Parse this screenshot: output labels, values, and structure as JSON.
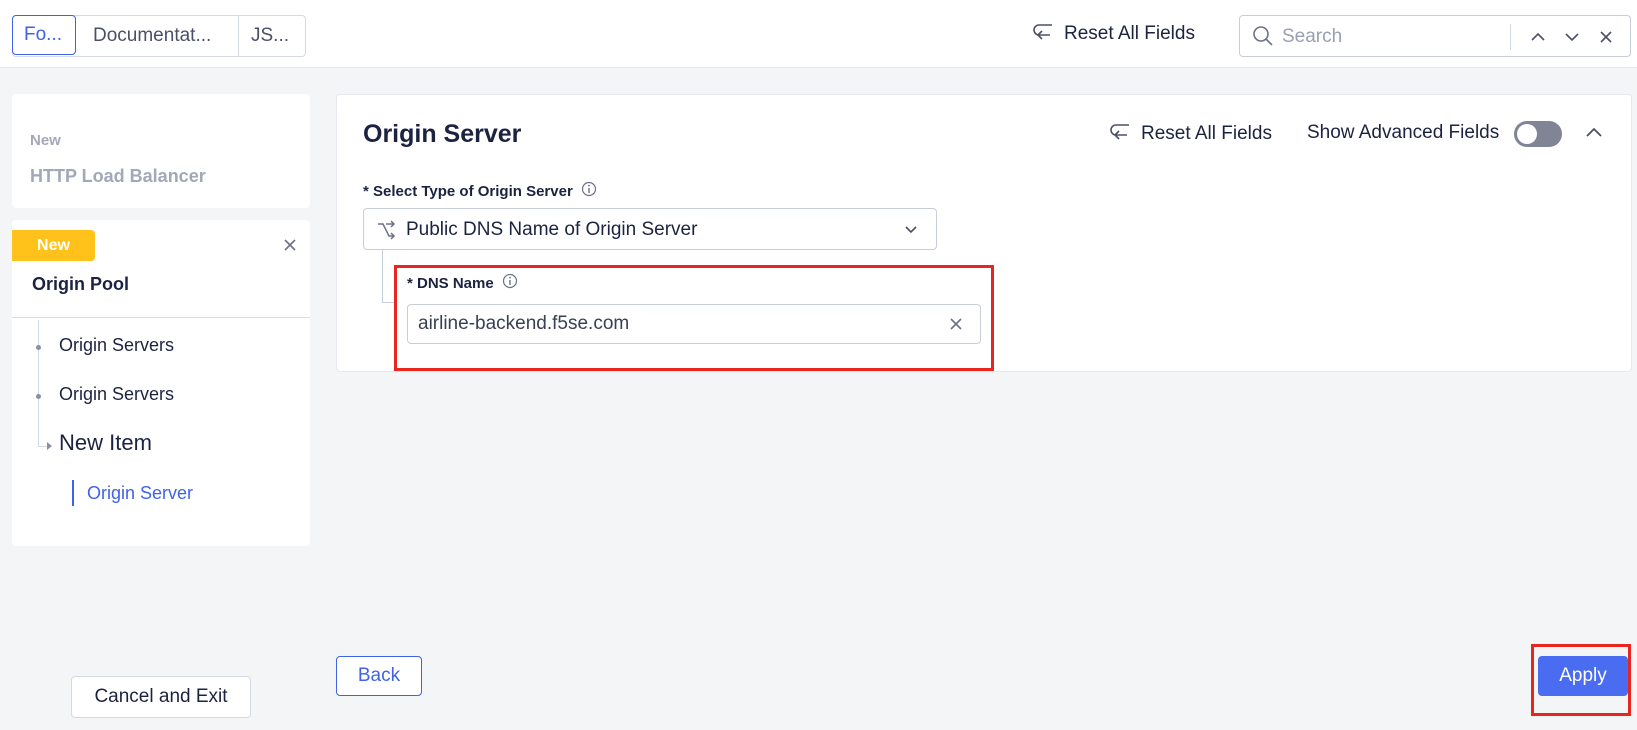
{
  "tabs": [
    {
      "label": "Fo...",
      "active": true
    },
    {
      "label": "Documentat...",
      "active": false
    },
    {
      "label": "JS...",
      "active": false
    }
  ],
  "toolbar": {
    "reset_label": "Reset All Fields",
    "search_placeholder": "Search"
  },
  "sidebar": {
    "lb_card": {
      "new_label": "New",
      "title": "HTTP Load Balancer"
    },
    "pool_card": {
      "badge": "New",
      "title": "Origin Pool",
      "tree": [
        {
          "label": "Origin Servers"
        },
        {
          "label": "Origin Servers"
        },
        {
          "label": "New Item"
        },
        {
          "label": "Origin Server",
          "active": true
        }
      ]
    },
    "cancel_label": "Cancel and Exit"
  },
  "form": {
    "title": "Origin Server",
    "reset_label": "Reset All Fields",
    "advanced_label": "Show Advanced Fields",
    "advanced_enabled": false,
    "type_field": {
      "label": "* Select Type of Origin Server",
      "value": "Public DNS Name of Origin Server"
    },
    "dns_field": {
      "label": "* DNS Name",
      "value": "airline-backend.f5se.com"
    }
  },
  "footer": {
    "back_label": "Back",
    "apply_label": "Apply"
  },
  "colors": {
    "accent": "#3f62e8",
    "apply_bg": "#4a6cf0",
    "badge": "#ffc21a",
    "highlight": "#e8261f"
  }
}
